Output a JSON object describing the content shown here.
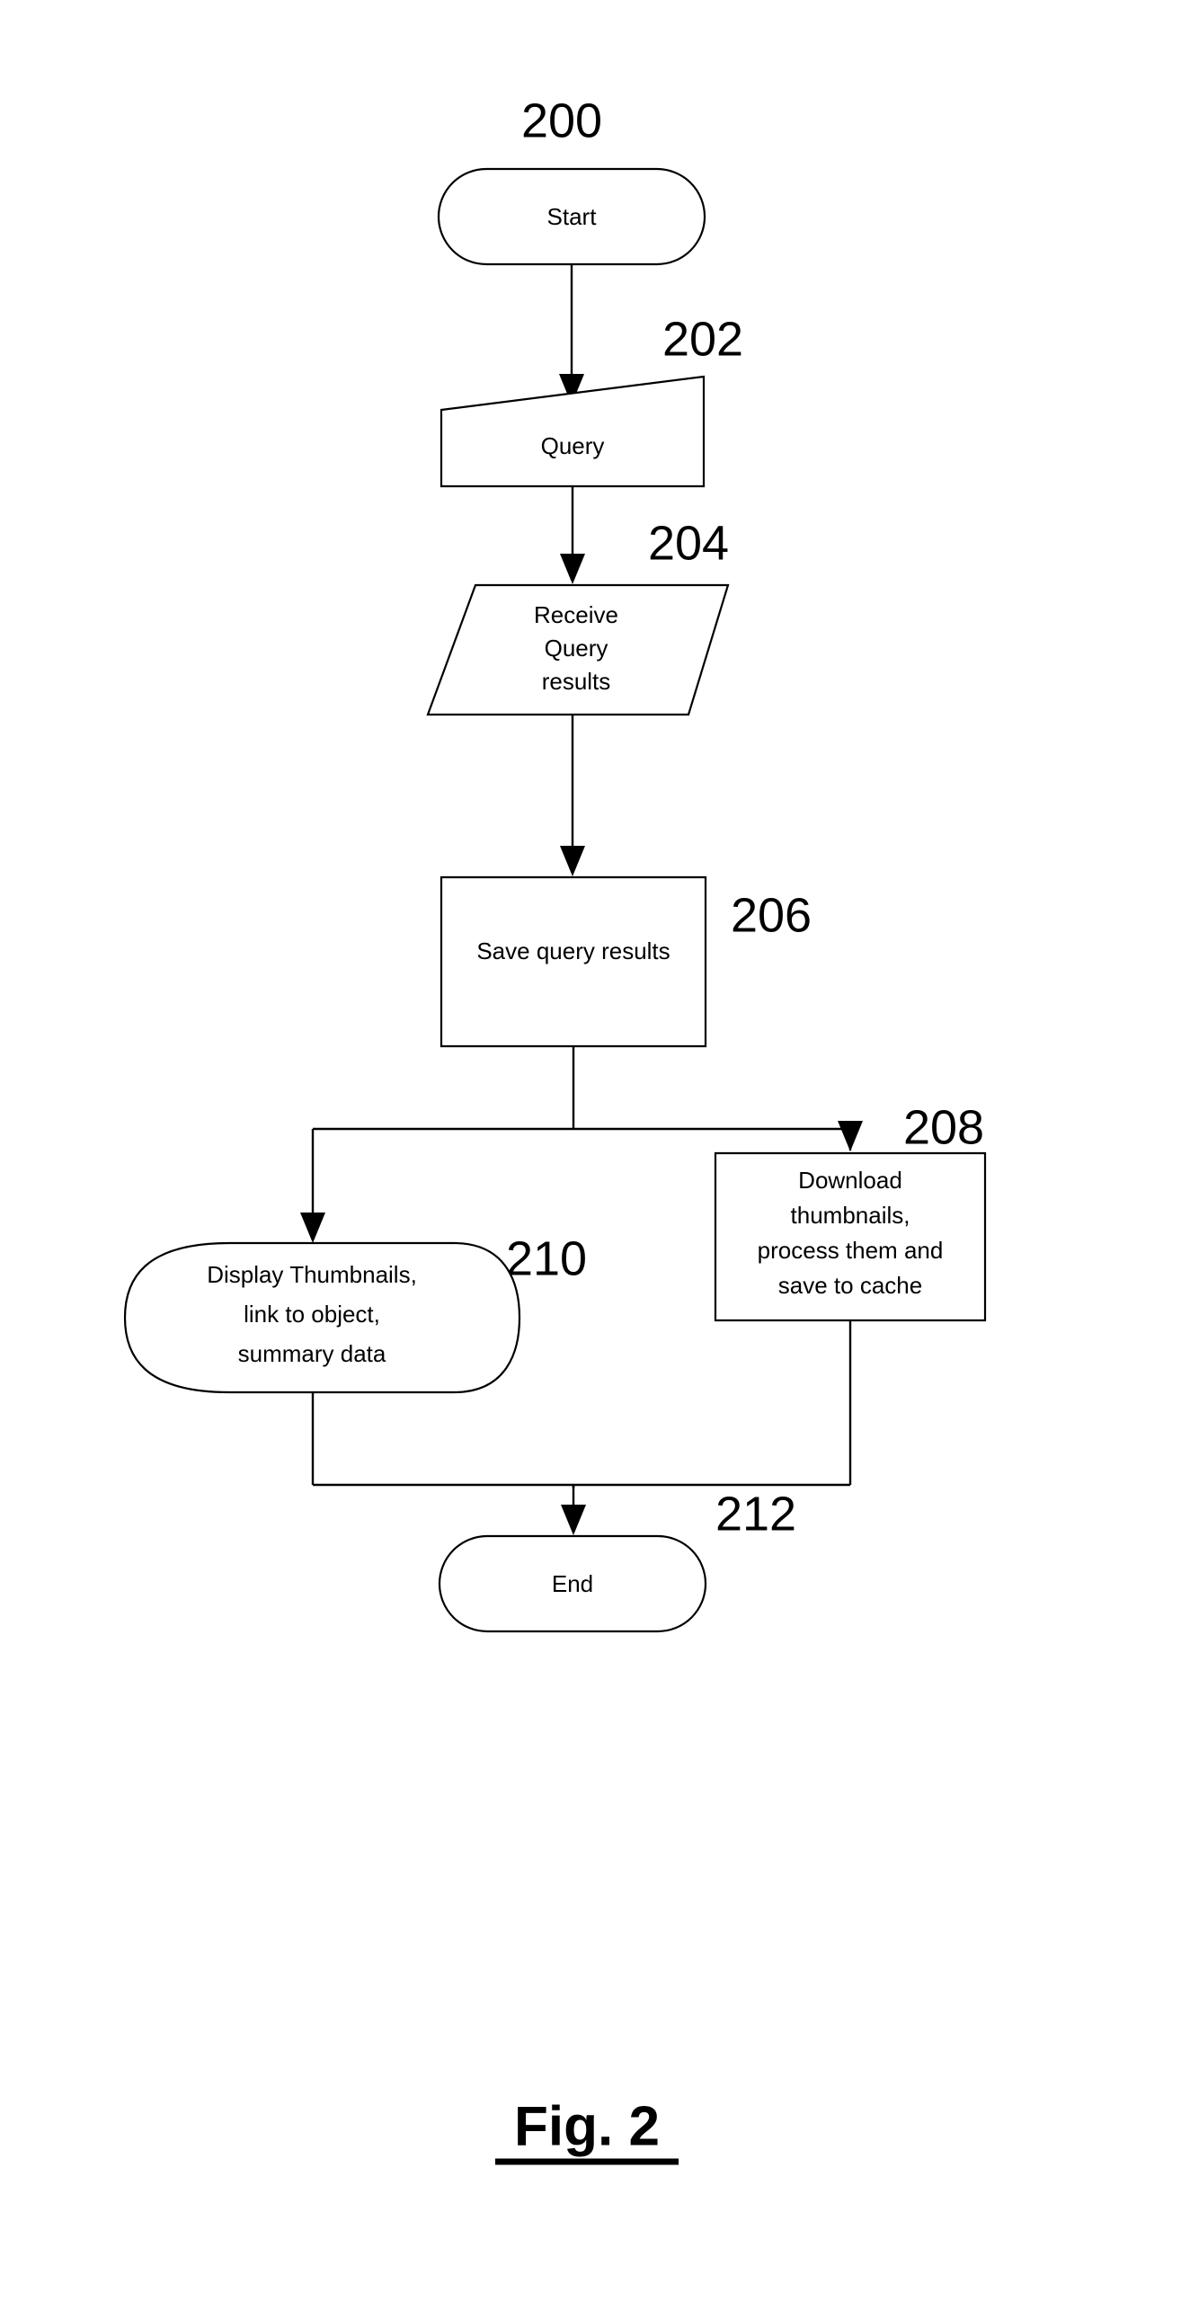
{
  "figure": {
    "caption": "Fig. 2",
    "caption_style": "bold-underlined",
    "background_color": "#ffffff",
    "line_color": "#000000"
  },
  "diagram": {
    "type": "flowchart",
    "orientation": "top-to-bottom",
    "nodes": [
      {
        "ref": "200",
        "label": "Start",
        "shape": "stadium",
        "lines": [
          "Start"
        ]
      },
      {
        "ref": "202",
        "label": "Query",
        "shape": "manual-input",
        "lines": [
          "Query"
        ]
      },
      {
        "ref": "204",
        "label": "Receive Query results",
        "shape": "parallelogram",
        "lines": [
          "Receive",
          "Query",
          "results"
        ]
      },
      {
        "ref": "206",
        "label": "Save query results",
        "shape": "rectangle",
        "lines": [
          "Save query results"
        ]
      },
      {
        "ref": "208",
        "label": "Download thumbnails, process them and save to cache",
        "shape": "rectangle",
        "lines": [
          "Download",
          "thumbnails,",
          "process them and",
          "save to cache"
        ]
      },
      {
        "ref": "210",
        "label": "Display Thumbnails, link to object, summary data",
        "shape": "display",
        "lines": [
          "Display Thumbnails,",
          "link to object,",
          "summary data"
        ]
      },
      {
        "ref": "212",
        "label": "End",
        "shape": "stadium",
        "lines": [
          "End"
        ]
      }
    ],
    "edges": [
      {
        "from": "200",
        "to": "202",
        "style": "straight-arrow"
      },
      {
        "from": "202",
        "to": "204",
        "style": "straight-arrow"
      },
      {
        "from": "204",
        "to": "206",
        "style": "straight-arrow"
      },
      {
        "from": "206",
        "to": "210",
        "style": "branch-left-arrow"
      },
      {
        "from": "206",
        "to": "208",
        "style": "branch-right-arrow"
      },
      {
        "from": "210",
        "to": "212",
        "style": "merge-arrow"
      },
      {
        "from": "208",
        "to": "212",
        "style": "merge-arrow"
      }
    ]
  }
}
